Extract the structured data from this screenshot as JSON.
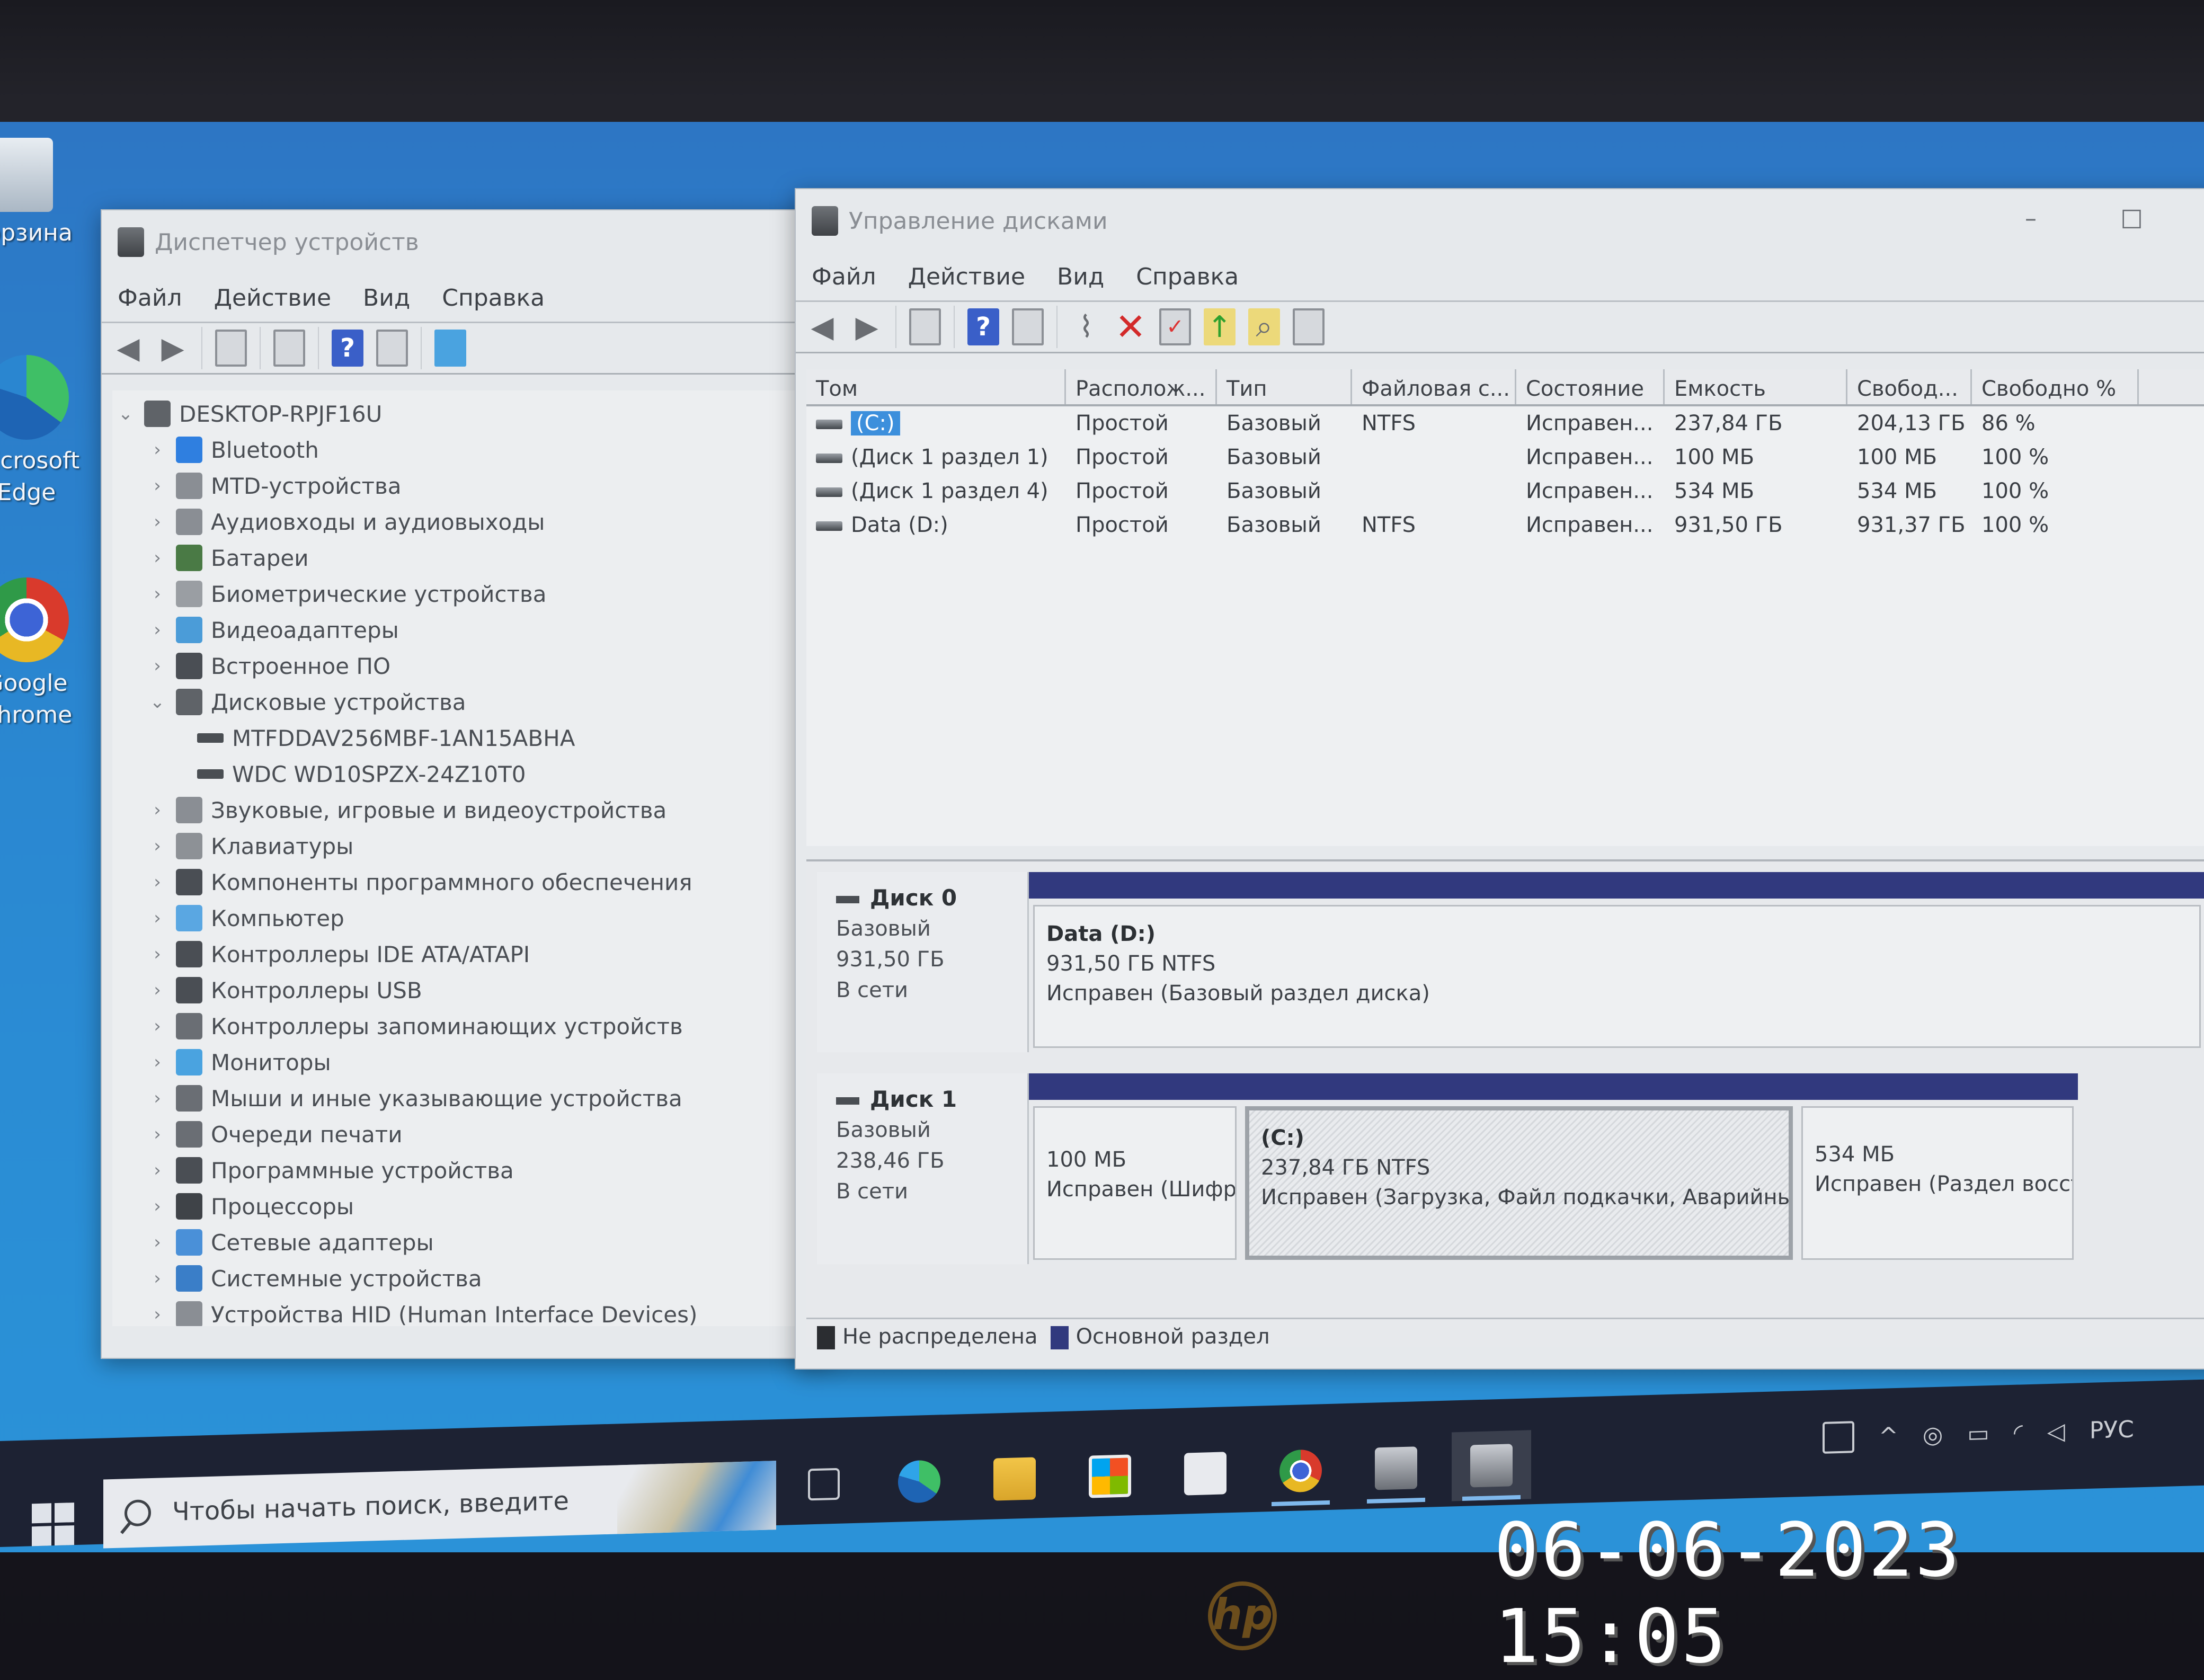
{
  "desktop": {
    "icons": [
      {
        "label": "Корзина",
        "icon": "recycle-bin-icon"
      },
      {
        "label": "Microsoft Edge",
        "icon": "edge-icon"
      },
      {
        "label": "Google Chrome",
        "icon": "chrome-icon"
      }
    ]
  },
  "device_manager": {
    "title": "Диспетчер устройств",
    "menu": [
      "Файл",
      "Действие",
      "Вид",
      "Справка"
    ],
    "toolbar": [
      "back-icon",
      "forward-icon",
      "properties-icon",
      "update-driver-icon",
      "help-icon",
      "show-hidden-icon",
      "monitor-icon"
    ],
    "root": "DESKTOP-RPJF16U",
    "nodes": [
      {
        "label": "Bluetooth",
        "expanded": false
      },
      {
        "label": "MTD-устройства",
        "expanded": false
      },
      {
        "label": "Аудиовходы и аудиовыходы",
        "expanded": false
      },
      {
        "label": "Батареи",
        "expanded": false
      },
      {
        "label": "Биометрические устройства",
        "expanded": false
      },
      {
        "label": "Видеоадаптеры",
        "expanded": false
      },
      {
        "label": "Встроенное ПО",
        "expanded": false
      },
      {
        "label": "Дисковые устройства",
        "expanded": true,
        "children": [
          "MTFDDAV256MBF-1AN15ABHA",
          "WDC WD10SPZX-24Z10T0"
        ]
      },
      {
        "label": "Звуковые, игровые и видеоустройства",
        "expanded": false
      },
      {
        "label": "Клавиатуры",
        "expanded": false
      },
      {
        "label": "Компоненты программного обеспечения",
        "expanded": false
      },
      {
        "label": "Компьютер",
        "expanded": false
      },
      {
        "label": "Контроллеры IDE ATA/ATAPI",
        "expanded": false
      },
      {
        "label": "Контроллеры USB",
        "expanded": false
      },
      {
        "label": "Контроллеры запоминающих устройств",
        "expanded": false
      },
      {
        "label": "Мониторы",
        "expanded": false
      },
      {
        "label": "Мыши и иные указывающие устройства",
        "expanded": false
      },
      {
        "label": "Очереди печати",
        "expanded": false
      },
      {
        "label": "Программные устройства",
        "expanded": false
      },
      {
        "label": "Процессоры",
        "expanded": false
      },
      {
        "label": "Сетевые адаптеры",
        "expanded": false
      },
      {
        "label": "Системные устройства",
        "expanded": false
      },
      {
        "label": "Устройства HID (Human Interface Devices)",
        "expanded": false
      }
    ]
  },
  "disk_management": {
    "title": "Управление дисками",
    "menu": [
      "Файл",
      "Действие",
      "Вид",
      "Справка"
    ],
    "window_controls": {
      "minimize": "–",
      "maximize": "☐"
    },
    "columns": [
      "Том",
      "Располож...",
      "Тип",
      "Файловая с...",
      "Состояние",
      "Емкость",
      "Свобод...",
      "Свободно %"
    ],
    "volumes": [
      {
        "name": "(C:)",
        "layout": "Простой",
        "type": "Базовый",
        "fs": "NTFS",
        "status": "Исправен...",
        "capacity": "237,84 ГБ",
        "free": "204,13 ГБ",
        "free_pct": "86 %",
        "selected": true
      },
      {
        "name": "(Диск 1 раздел 1)",
        "layout": "Простой",
        "type": "Базовый",
        "fs": "",
        "status": "Исправен...",
        "capacity": "100 МБ",
        "free": "100 МБ",
        "free_pct": "100 %"
      },
      {
        "name": "(Диск 1 раздел 4)",
        "layout": "Простой",
        "type": "Базовый",
        "fs": "",
        "status": "Исправен...",
        "capacity": "534 МБ",
        "free": "534 МБ",
        "free_pct": "100 %"
      },
      {
        "name": "Data (D:)",
        "layout": "Простой",
        "type": "Базовый",
        "fs": "NTFS",
        "status": "Исправен...",
        "capacity": "931,50 ГБ",
        "free": "931,37 ГБ",
        "free_pct": "100 %"
      }
    ],
    "disks": [
      {
        "name": "Диск 0",
        "type": "Базовый",
        "size": "931,50 ГБ",
        "state": "В сети",
        "partitions": [
          {
            "title": "Data  (D:)",
            "size": "931,50 ГБ NTFS",
            "status": "Исправен (Базовый раздел диска)"
          }
        ]
      },
      {
        "name": "Диск 1",
        "type": "Базовый",
        "size": "238,46 ГБ",
        "state": "В сети",
        "partitions": [
          {
            "title": "",
            "size": "100 МБ",
            "status": "Исправен (Шифр"
          },
          {
            "title": "(C:)",
            "size": "237,84 ГБ NTFS",
            "status": "Исправен (Загрузка, Файл подкачки, Аварийный д"
          },
          {
            "title": "",
            "size": "534 МБ",
            "status": "Исправен (Раздел восста"
          }
        ]
      }
    ],
    "legend": [
      {
        "label": "Не распределена",
        "color": "#2b2d31"
      },
      {
        "label": "Основной раздел",
        "color": "#31397e"
      }
    ]
  },
  "taskbar": {
    "search_placeholder": "Чтобы начать поиск, введите",
    "apps": [
      "task-view-icon",
      "edge-icon",
      "file-explorer-icon",
      "store-icon",
      "mail-icon",
      "chrome-icon",
      "device-manager-icon",
      "disk-management-icon"
    ],
    "tray": {
      "language": "РУС"
    }
  },
  "camera_stamp": "06-06-2023 15:05",
  "colors": {
    "partition_bar": "#31397e",
    "desktop": "#2a86d0",
    "selection": "#3c8fdc"
  }
}
